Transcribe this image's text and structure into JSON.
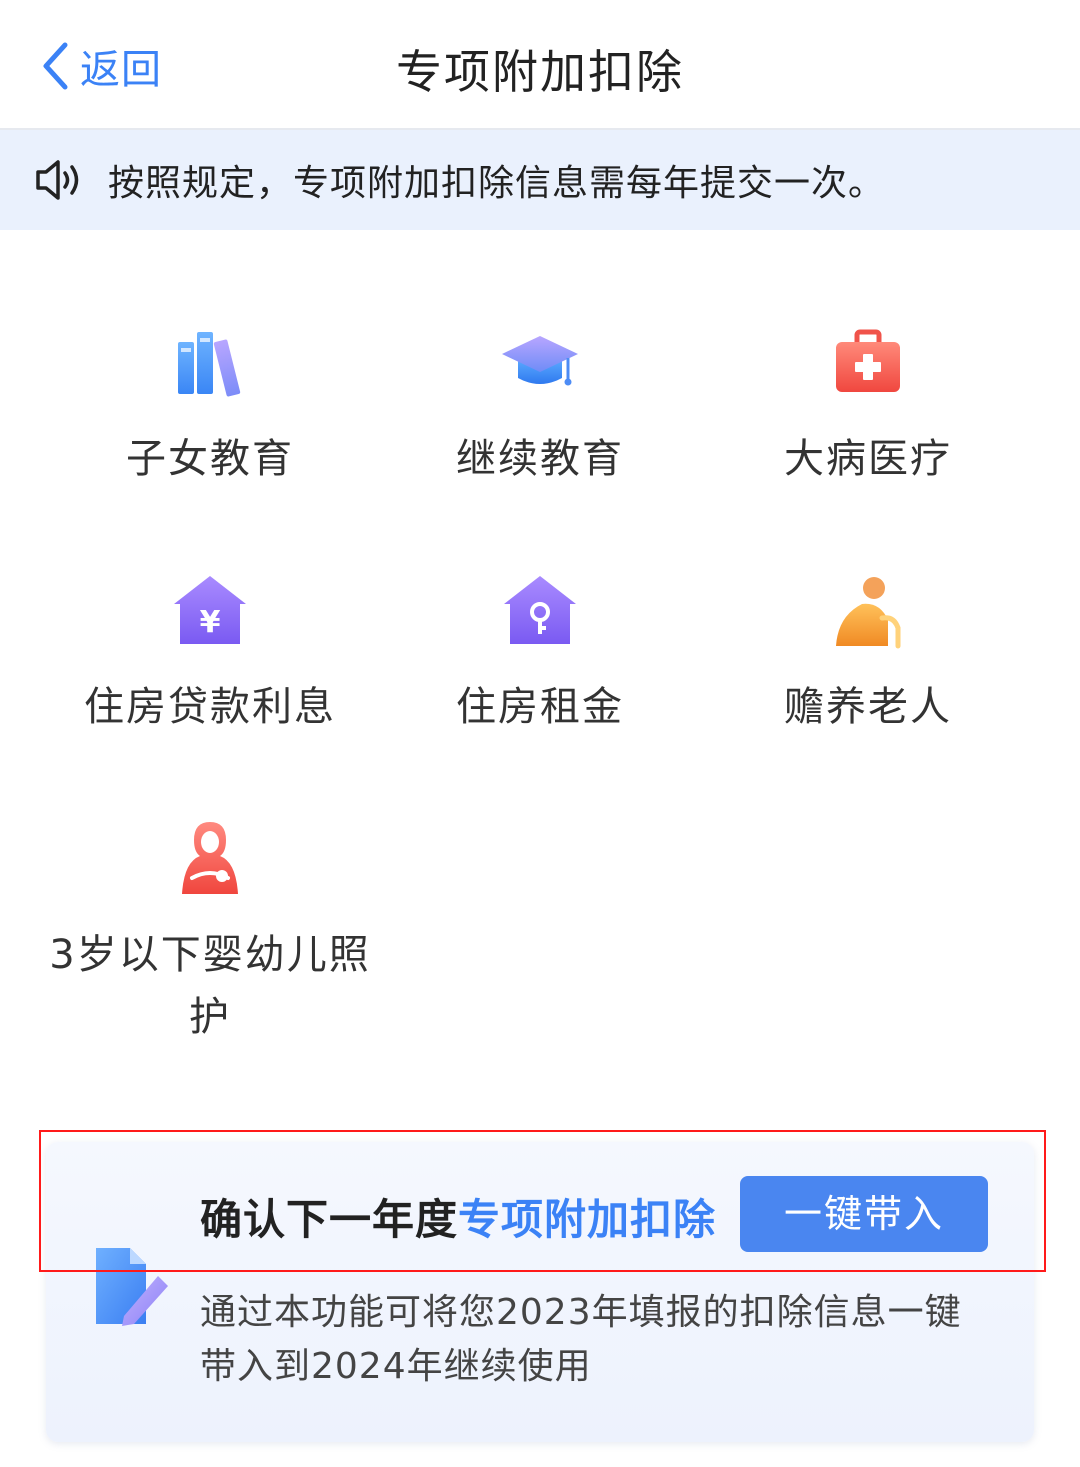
{
  "header": {
    "back_label": "返回",
    "title": "专项附加扣除"
  },
  "notice": {
    "text": "按照规定，专项附加扣除信息需每年提交一次。"
  },
  "categories": [
    {
      "label": "子女教育",
      "icon": "books-icon"
    },
    {
      "label": "继续教育",
      "icon": "graduation-cap-icon"
    },
    {
      "label": "大病医疗",
      "icon": "medical-kit-icon"
    },
    {
      "label": "住房贷款利息",
      "icon": "house-yuan-icon"
    },
    {
      "label": "住房租金",
      "icon": "house-key-icon"
    },
    {
      "label": "赡养老人",
      "icon": "elderly-person-icon"
    },
    {
      "label": "3岁以下婴幼儿照护",
      "icon": "mother-baby-icon"
    }
  ],
  "card": {
    "title_prefix": "确认下一年度",
    "title_highlight": "专项附加扣除",
    "button_label": "一键带入",
    "description": "通过本功能可将您2023年填报的扣除信息一键带入到2024年继续使用",
    "icon": "document-edit-icon"
  },
  "colors": {
    "accent": "#3b82f6",
    "notice_bg": "#eaf1fd",
    "button_bg": "#4a86f0",
    "highlight_border": "#ff1a1a"
  }
}
